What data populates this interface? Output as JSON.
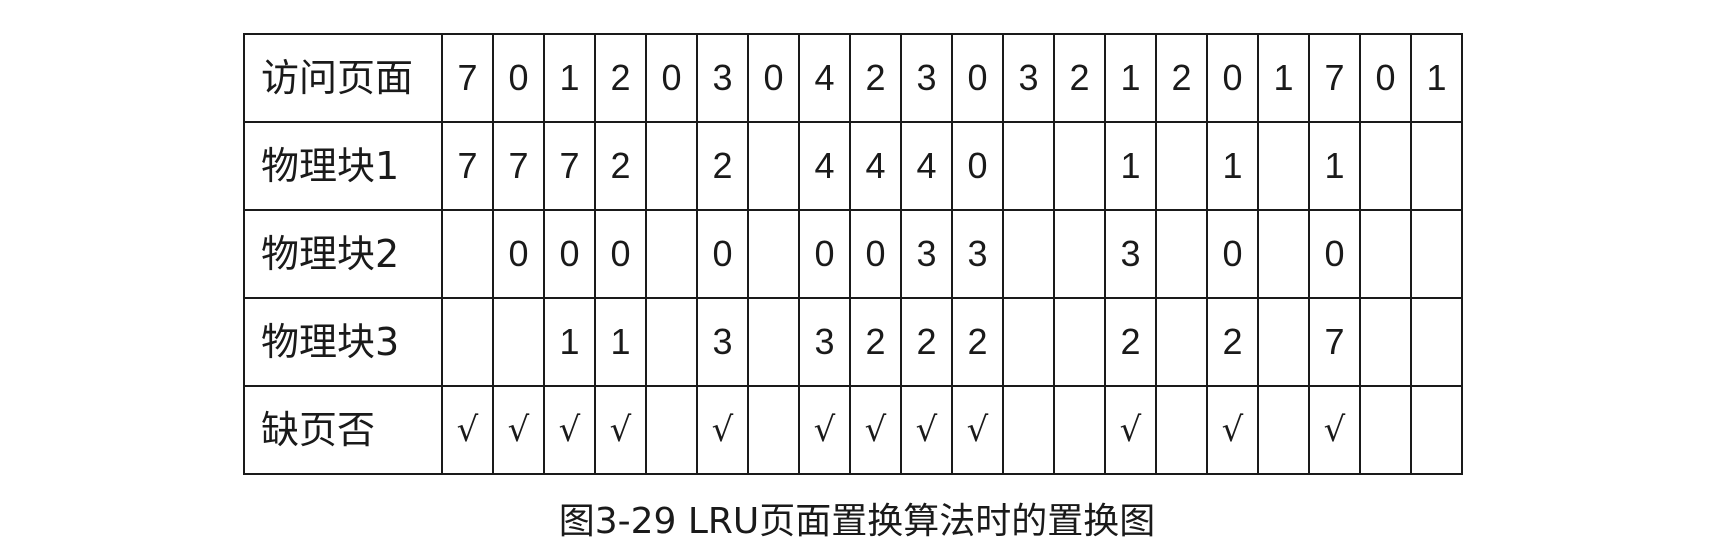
{
  "table": {
    "rows": [
      {
        "label": "访问页面",
        "cells": [
          "7",
          "0",
          "1",
          "2",
          "0",
          "3",
          "0",
          "4",
          "2",
          "3",
          "0",
          "3",
          "2",
          "1",
          "2",
          "0",
          "1",
          "7",
          "0",
          "1"
        ]
      },
      {
        "label": "物理块1",
        "cells": [
          "7",
          "7",
          "7",
          "2",
          "",
          "2",
          "",
          "4",
          "4",
          "4",
          "0",
          "",
          "",
          "1",
          "",
          "1",
          "",
          "1",
          "",
          ""
        ]
      },
      {
        "label": "物理块2",
        "cells": [
          "",
          "0",
          "0",
          "0",
          "",
          "0",
          "",
          "0",
          "0",
          "3",
          "3",
          "",
          "",
          "3",
          "",
          "0",
          "",
          "0",
          "",
          ""
        ]
      },
      {
        "label": "物理块3",
        "cells": [
          "",
          "",
          "1",
          "1",
          "",
          "3",
          "",
          "3",
          "2",
          "2",
          "2",
          "",
          "",
          "2",
          "",
          "2",
          "",
          "7",
          "",
          ""
        ]
      },
      {
        "label": "缺页否",
        "cells": [
          "√",
          "√",
          "√",
          "√",
          "",
          "√",
          "",
          "√",
          "√",
          "√",
          "√",
          "",
          "",
          "√",
          "",
          "√",
          "",
          "√",
          "",
          ""
        ]
      }
    ]
  },
  "caption": "图3-29  LRU页面置换算法时的置换图"
}
